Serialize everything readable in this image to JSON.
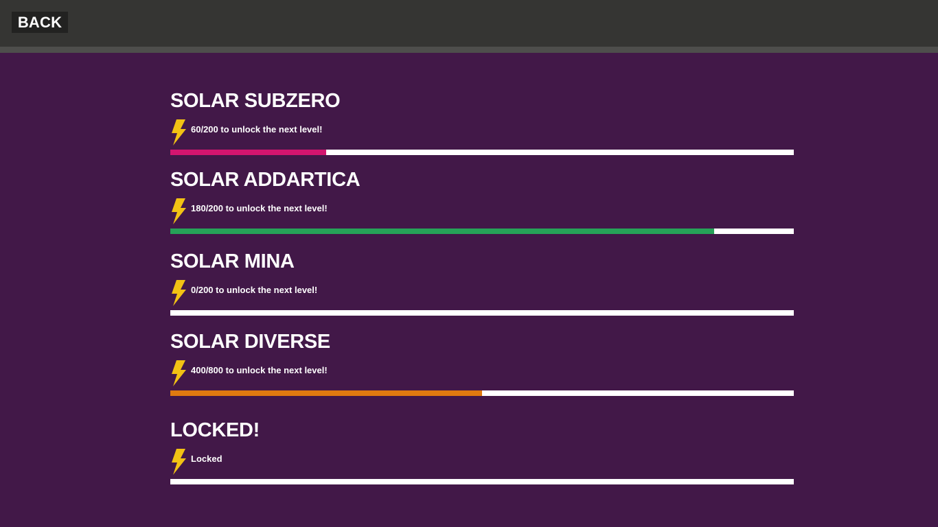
{
  "header": {
    "back_label": "BACK"
  },
  "levels": [
    {
      "title": "SOLAR SUBZERO",
      "status": "60/200 to unlock the next level!",
      "progress": 0.25,
      "color": "#d3156f"
    },
    {
      "title": "SOLAR ADDARTICA",
      "status": "180/200 to unlock the next level!",
      "progress": 0.872,
      "color": "#26a258"
    },
    {
      "title": "SOLAR MINA",
      "status": "0/200 to unlock the next level!",
      "progress": 0,
      "color": "#d3156f"
    },
    {
      "title": "SOLAR DIVERSE",
      "status": "400/800 to unlock the next level!",
      "progress": 0.5,
      "color": "#e07a10"
    },
    {
      "title": "LOCKED!",
      "status": "Locked",
      "progress": 0,
      "color": "#888888"
    }
  ],
  "icons": {
    "bolt": "lightning-bolt-icon",
    "bolt_color": "#f2c214"
  }
}
